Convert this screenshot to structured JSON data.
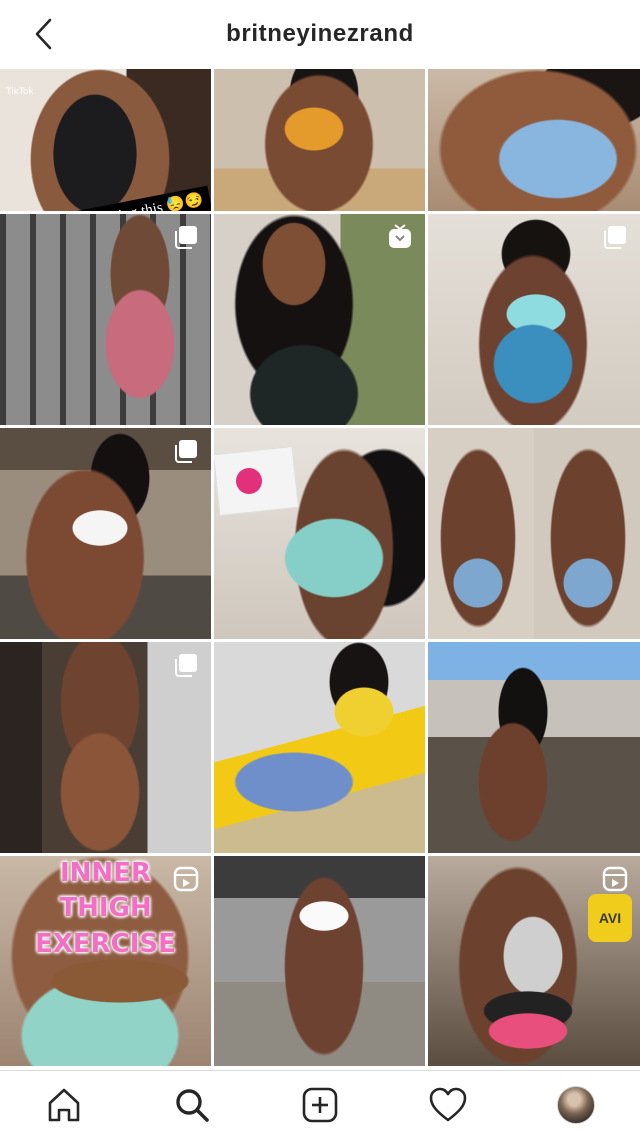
{
  "header": {
    "username": "britneyinezrand",
    "back_icon": "chevron-left-icon"
  },
  "posts": [
    {
      "id": "p1",
      "badge": "none",
      "caption": "I can't stand hearing this 😓😏",
      "watermark": "TikTok"
    },
    {
      "id": "p2",
      "badge": "none"
    },
    {
      "id": "p3",
      "badge": "none"
    },
    {
      "id": "p4",
      "badge": "carousel-icon"
    },
    {
      "id": "p5",
      "badge": "igtv-icon"
    },
    {
      "id": "p6",
      "badge": "carousel-icon"
    },
    {
      "id": "p7",
      "badge": "carousel-icon"
    },
    {
      "id": "p8",
      "badge": "none"
    },
    {
      "id": "p9",
      "badge": "none"
    },
    {
      "id": "p10",
      "badge": "carousel-icon"
    },
    {
      "id": "p11",
      "badge": "none"
    },
    {
      "id": "p12",
      "badge": "none"
    },
    {
      "id": "p13",
      "badge": "reels-icon",
      "overlay_lines": [
        "INNER",
        "THIGH",
        "EXERCISE"
      ]
    },
    {
      "id": "p14",
      "badge": "none"
    },
    {
      "id": "p15",
      "badge": "reels-icon",
      "mug_text": "AVI"
    }
  ],
  "bottom_nav": {
    "items": [
      "home-icon",
      "search-icon",
      "new-post-icon",
      "activity-heart-icon",
      "profile-avatar"
    ]
  }
}
